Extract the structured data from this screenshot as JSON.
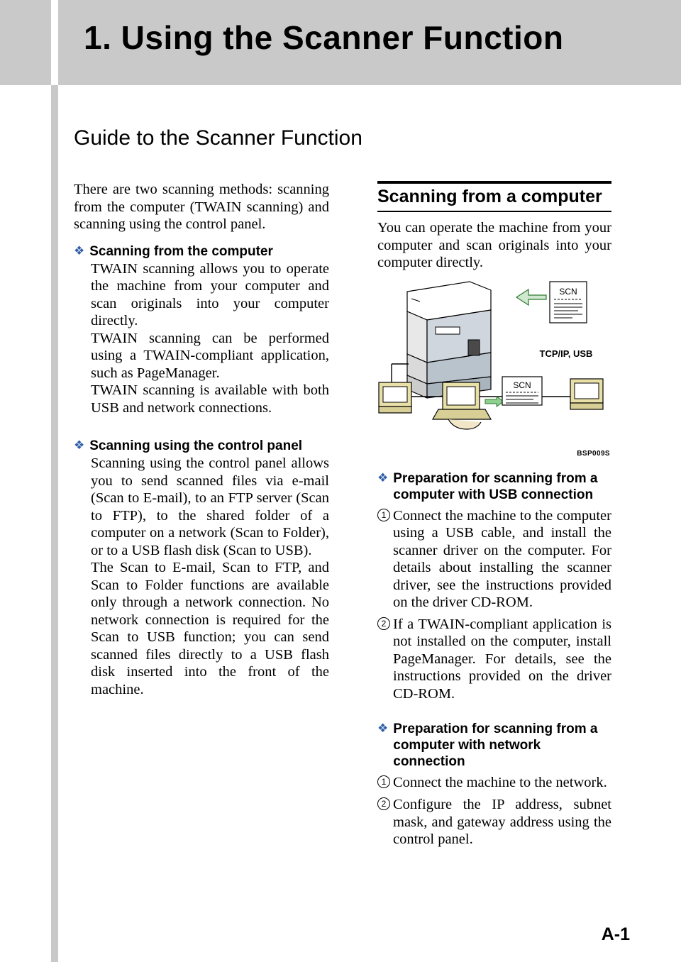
{
  "header": {
    "chapter_title": "1. Using the Scanner Function"
  },
  "section": {
    "title": "Guide to the Scanner Function"
  },
  "left_column": {
    "intro": "There are two scanning methods: scanning from the computer (TWAIN scanning) and scanning using the control panel.",
    "bullet1": {
      "heading": "Scanning from the computer",
      "para1": "TWAIN scanning allows you to operate the machine from your computer and scan originals into your computer directly.",
      "para2": "TWAIN scanning can be performed using a TWAIN-compliant application, such as PageManager.",
      "para3": "TWAIN scanning is available with both USB and network connections."
    },
    "bullet2": {
      "heading": "Scanning using the control panel",
      "para1": "Scanning using the control panel allows you to send scanned files via e-mail (Scan to E-mail), to an FTP server (Scan to FTP), to the shared folder of a computer on a network (Scan to Folder), or to a USB flash disk (Scan to USB).",
      "para2": "The Scan to E-mail, Scan to FTP, and Scan to Folder functions are available only through a network connection. No network connection is required for the Scan to USB function; you can send scanned files directly to a USB flash disk inserted into the front of the machine."
    }
  },
  "right_column": {
    "box_heading": "Scanning from a computer",
    "intro": "You can operate the machine from your computer and scan originals into your computer directly.",
    "figure": {
      "label_scn_top": "SCN",
      "label_scn_bottom": "SCN",
      "label_connection": "TCP/IP, USB",
      "figure_code": "BSP009S"
    },
    "bullet_usb": {
      "heading": "Preparation for scanning from a computer with USB connection",
      "item1_num": "1",
      "item1": "Connect the machine to the computer using a USB cable, and install the scanner driver on the computer. For details about installing the scanner driver, see the instructions provided on the driver CD-ROM.",
      "item2_num": "2",
      "item2": "If a TWAIN-compliant application is not installed on the computer, install PageManager. For details, see the instructions provided on the driver CD-ROM."
    },
    "bullet_network": {
      "heading": "Preparation for scanning from a computer with network connection",
      "item1_num": "1",
      "item1": "Connect the machine to the network.",
      "item2_num": "2",
      "item2": "Configure the IP address, subnet mask, and gateway address using the control panel."
    }
  },
  "footer": {
    "page_number": "A-1"
  },
  "colors": {
    "header_band": "#c9c9c9",
    "bullet_marker": "#2f5fa8",
    "accent_green": "#7fbf7f"
  }
}
